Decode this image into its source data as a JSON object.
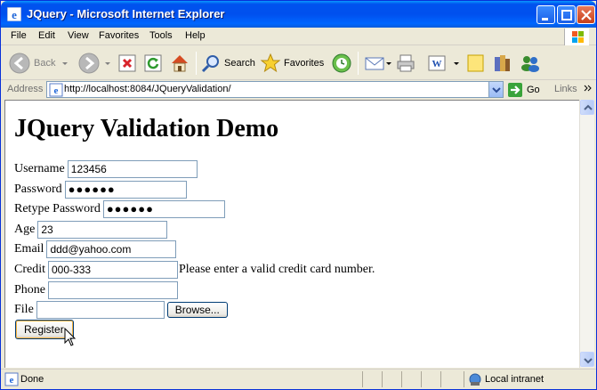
{
  "window": {
    "title": "JQuery - Microsoft Internet Explorer"
  },
  "menu": [
    "File",
    "Edit",
    "View",
    "Favorites",
    "Tools",
    "Help"
  ],
  "toolbar": {
    "back": "Back",
    "search": "Search",
    "favorites": "Favorites"
  },
  "address": {
    "label": "Address",
    "url": "http://localhost:8084/JQueryValidation/",
    "go": "Go",
    "links": "Links"
  },
  "page": {
    "heading": "JQuery Validation Demo",
    "fields": {
      "username": {
        "label": "Username",
        "value": "123456"
      },
      "password": {
        "label": "Password",
        "value": "●●●●●●"
      },
      "retype": {
        "label": "Retype Password",
        "value": "●●●●●●"
      },
      "age": {
        "label": "Age",
        "value": "23"
      },
      "email": {
        "label": "Email",
        "value": "ddd@yahoo.com"
      },
      "credit": {
        "label": "Credit",
        "value": "000-333",
        "error": "Please enter a valid credit card number."
      },
      "phone": {
        "label": "Phone",
        "value": ""
      },
      "file": {
        "label": "File",
        "value": "",
        "browse": "Browse..."
      }
    },
    "register": "Register"
  },
  "status": {
    "text": "Done",
    "zone": "Local intranet"
  },
  "colors": {
    "titlebar": "#0053ee",
    "chrome": "#ece9d8",
    "input_border": "#7f9db9"
  }
}
